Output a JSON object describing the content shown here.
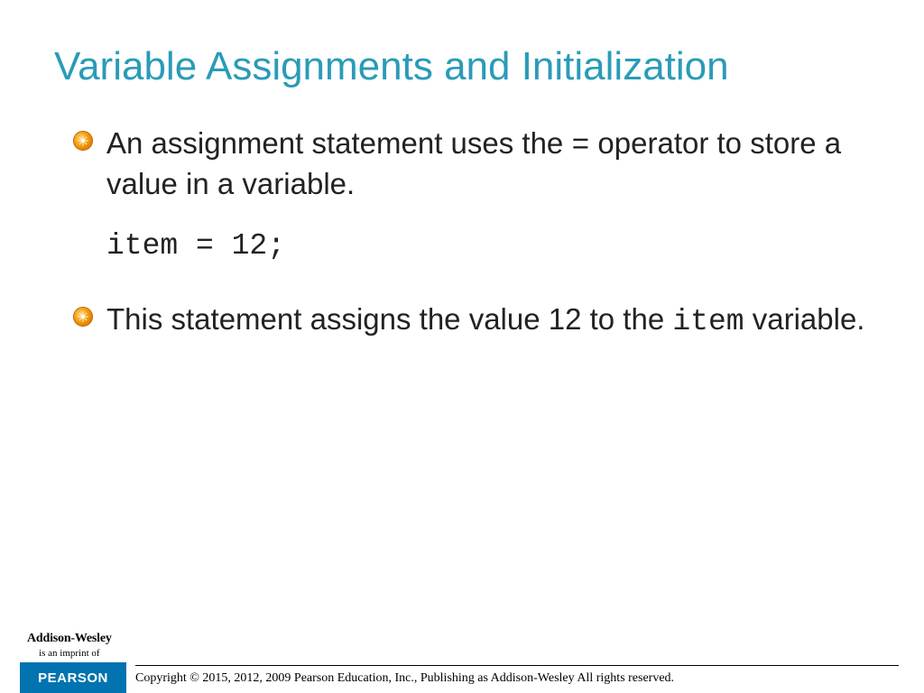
{
  "title": "Variable Assignments and Initialization",
  "bullets": [
    {
      "text_before_code": "An assignment statement uses the ",
      "inline_code_1": "=",
      "text_mid": " operator to store a value in a variable.",
      "code_line": "item = 12;"
    },
    {
      "text_before_code": "This statement assigns the value 12 to the ",
      "inline_code_1": "item",
      "text_mid": " variable."
    }
  ],
  "footer": {
    "imprint_line1": "Addison-Wesley",
    "imprint_line2": "is an imprint of",
    "brand": "PEARSON",
    "copyright": "Copyright © 2015, 2012, 2009 Pearson Education, Inc., Publishing as Addison-Wesley All rights reserved."
  }
}
